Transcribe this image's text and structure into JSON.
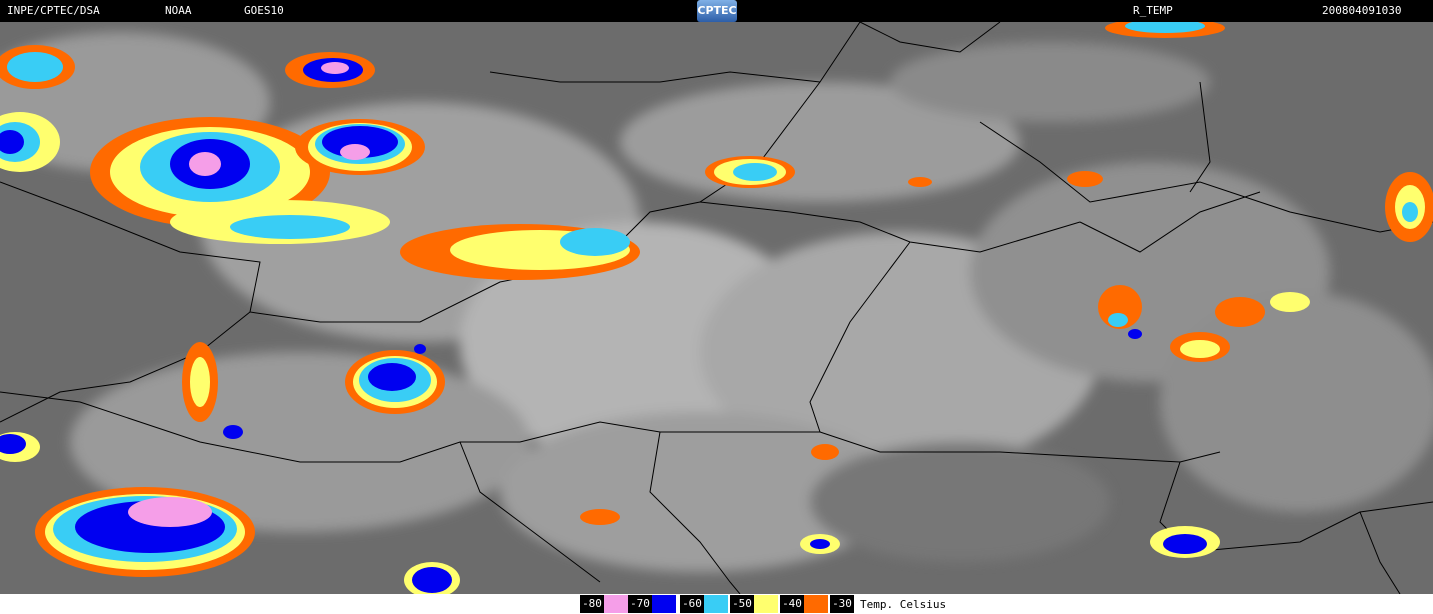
{
  "header": {
    "source": "INPE/CPTEC/DSA",
    "agency": "NOAA",
    "satellite": "GOES10",
    "logo_text": "CPTEC",
    "product": "R_TEMP",
    "timestamp": "200804091030"
  },
  "legend": {
    "unit": "Temp. Celsius",
    "items": [
      {
        "label": "-80",
        "color": "#f59ee8"
      },
      {
        "label": "-70",
        "color": "#0000f0"
      },
      {
        "label": "-60",
        "color": "#39cdf5"
      },
      {
        "label": "-50",
        "color": "#ffff6e"
      },
      {
        "label": "-40",
        "color": "#ff6a00"
      },
      {
        "label": "-30",
        "color": "#ffffff"
      }
    ]
  },
  "colors": {
    "background_ir": "#6f6f6f",
    "clouds_ir": "#a8a8a8",
    "borders": "#000000"
  }
}
